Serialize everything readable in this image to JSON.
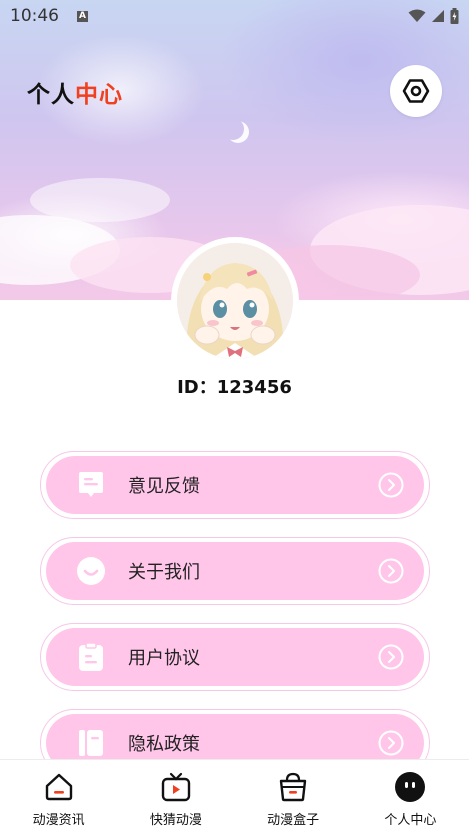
{
  "status_bar": {
    "time": "10:46",
    "notification_badge": "A",
    "icons": [
      "wifi-icon",
      "signal-icon",
      "battery-icon"
    ]
  },
  "header": {
    "title_prefix": "个人",
    "title_accent": "中心",
    "accent_color": "#f0401f",
    "settings_icon": "settings-hexagon-icon"
  },
  "profile": {
    "avatar": "anime-girl-avatar",
    "id_text": "ID：123456"
  },
  "menu": {
    "fill_color": "#ffc6ea",
    "items": [
      {
        "label": "意见反馈",
        "icon": "feedback-message-icon"
      },
      {
        "label": "关于我们",
        "icon": "smile-face-icon"
      },
      {
        "label": "用户协议",
        "icon": "clipboard-icon"
      },
      {
        "label": "隐私政策",
        "icon": "notebook-icon"
      }
    ],
    "arrow_icon": "chevron-right-circle-icon"
  },
  "bottom_nav": {
    "items": [
      {
        "label": "动漫资讯",
        "icon": "home-icon"
      },
      {
        "label": "快猜动漫",
        "icon": "tv-play-icon"
      },
      {
        "label": "动漫盒子",
        "icon": "basket-box-icon"
      },
      {
        "label": "个人中心",
        "icon": "profile-face-icon",
        "active": true
      }
    ]
  }
}
